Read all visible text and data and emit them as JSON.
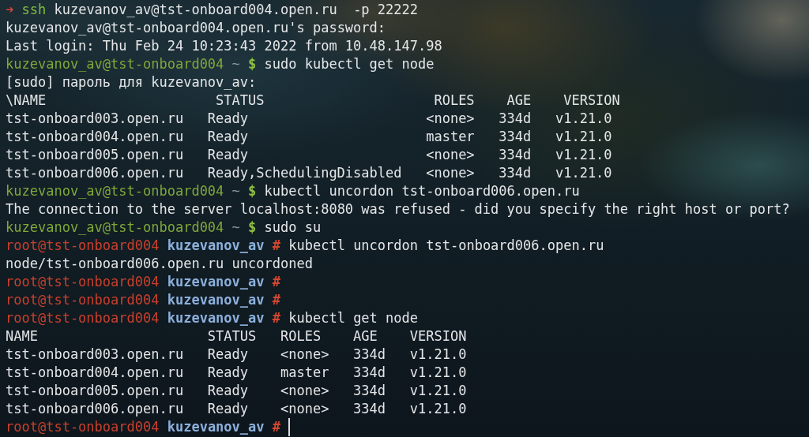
{
  "terminal": {
    "lines": [
      {
        "kind": "shell_command",
        "symbol": "➜",
        "program": "ssh",
        "arguments": "kuzevanov_av@tst-onboard004.open.ru  -p 22222"
      },
      {
        "kind": "output",
        "text": "kuzevanov_av@tst-onboard004.open.ru's password:"
      },
      {
        "kind": "output",
        "text": "Last login: Thu Feb 24 10:23:43 2022 from 10.48.147.98"
      },
      {
        "kind": "user_prompt",
        "user_host": "kuzevanov_av@tst-onboard004",
        "directory": "~",
        "symbol": "$",
        "command": "sudo kubectl get node"
      },
      {
        "kind": "output",
        "text": "[sudo] пароль для kuzevanov_av:"
      },
      {
        "kind": "table",
        "stray_input": "\\",
        "columns": [
          "NAME",
          "STATUS",
          "ROLES",
          "AGE",
          "VERSION"
        ],
        "rows": [
          [
            "tst-onboard003.open.ru",
            "Ready",
            "<none>",
            "334d",
            "v1.21.0"
          ],
          [
            "tst-onboard004.open.ru",
            "Ready",
            "master",
            "334d",
            "v1.21.0"
          ],
          [
            "tst-onboard005.open.ru",
            "Ready",
            "<none>",
            "334d",
            "v1.21.0"
          ],
          [
            "tst-onboard006.open.ru",
            "Ready,SchedulingDisabled",
            "<none>",
            "334d",
            "v1.21.0"
          ]
        ]
      },
      {
        "kind": "user_prompt",
        "user_host": "kuzevanov_av@tst-onboard004",
        "directory": "~",
        "symbol": "$",
        "command": "kubectl uncordon tst-onboard006.open.ru"
      },
      {
        "kind": "output",
        "text": "The connection to the server localhost:8080 was refused - did you specify the right host or port?"
      },
      {
        "kind": "user_prompt",
        "user_host": "kuzevanov_av@tst-onboard004",
        "directory": "~",
        "symbol": "$",
        "command": "sudo su"
      },
      {
        "kind": "root_prompt",
        "user_host": "root@tst-onboard004",
        "directory": "kuzevanov_av",
        "symbol": "#",
        "command": "kubectl uncordon tst-onboard006.open.ru"
      },
      {
        "kind": "output",
        "text": "node/tst-onboard006.open.ru uncordoned"
      },
      {
        "kind": "root_prompt",
        "user_host": "root@tst-onboard004",
        "directory": "kuzevanov_av",
        "symbol": "#"
      },
      {
        "kind": "root_prompt",
        "user_host": "root@tst-onboard004",
        "directory": "kuzevanov_av",
        "symbol": "#"
      },
      {
        "kind": "root_prompt",
        "user_host": "root@tst-onboard004",
        "directory": "kuzevanov_av",
        "symbol": "#",
        "command": "kubectl get node"
      },
      {
        "kind": "table",
        "columns": [
          "NAME",
          "STATUS",
          "ROLES",
          "AGE",
          "VERSION"
        ],
        "rows": [
          [
            "tst-onboard003.open.ru",
            "Ready",
            "<none>",
            "334d",
            "v1.21.0"
          ],
          [
            "tst-onboard004.open.ru",
            "Ready",
            "master",
            "334d",
            "v1.21.0"
          ],
          [
            "tst-onboard005.open.ru",
            "Ready",
            "<none>",
            "334d",
            "v1.21.0"
          ],
          [
            "tst-onboard006.open.ru",
            "Ready",
            "<none>",
            "334d",
            "v1.21.0"
          ]
        ]
      },
      {
        "kind": "root_prompt",
        "user_host": "root@tst-onboard004",
        "directory": "kuzevanov_av",
        "symbol": "#",
        "cursor": true
      }
    ]
  }
}
